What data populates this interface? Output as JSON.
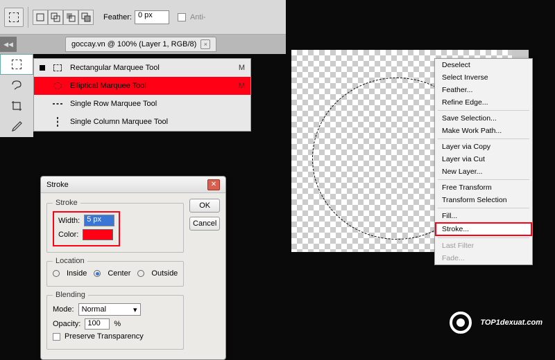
{
  "options_bar": {
    "feather_label": "Feather:",
    "feather_value": "0 px",
    "anti_alias_label": "Anti-"
  },
  "tab": {
    "title": "goccay.vn @ 100% (Layer 1, RGB/8)"
  },
  "marquee_flyout": {
    "items": [
      {
        "label": "Rectangular Marquee Tool",
        "key": "M"
      },
      {
        "label": "Elliptical Marquee Tool",
        "key": "M"
      },
      {
        "label": "Single Row Marquee Tool",
        "key": ""
      },
      {
        "label": "Single Column Marquee Tool",
        "key": ""
      }
    ]
  },
  "stroke_dialog": {
    "title": "Stroke",
    "ok": "OK",
    "cancel": "Cancel",
    "group_stroke": "Stroke",
    "width_label": "Width:",
    "width_value": "5 px",
    "color_label": "Color:",
    "color_hex": "#ff0015",
    "group_location": "Location",
    "loc_inside": "Inside",
    "loc_center": "Center",
    "loc_outside": "Outside",
    "group_blending": "Blending",
    "mode_label": "Mode:",
    "mode_value": "Normal",
    "opacity_label": "Opacity:",
    "opacity_value": "100",
    "opacity_unit": "%",
    "preserve": "Preserve Transparency"
  },
  "context_menu": {
    "items": [
      {
        "label": "Deselect",
        "disabled": false
      },
      {
        "label": "Select Inverse",
        "disabled": false
      },
      {
        "label": "Feather...",
        "disabled": false
      },
      {
        "label": "Refine Edge...",
        "disabled": false
      },
      {
        "sep": true
      },
      {
        "label": "Save Selection...",
        "disabled": false
      },
      {
        "label": "Make Work Path...",
        "disabled": false
      },
      {
        "sep": true
      },
      {
        "label": "Layer via Copy",
        "disabled": false
      },
      {
        "label": "Layer via Cut",
        "disabled": false
      },
      {
        "label": "New Layer...",
        "disabled": false
      },
      {
        "sep": true
      },
      {
        "label": "Free Transform",
        "disabled": false
      },
      {
        "label": "Transform Selection",
        "disabled": false
      },
      {
        "sep": true
      },
      {
        "label": "Fill...",
        "disabled": false
      },
      {
        "label": "Stroke...",
        "disabled": false,
        "highlight": true
      },
      {
        "sep": true
      },
      {
        "label": "Last Filter",
        "disabled": true
      },
      {
        "label": "Fade...",
        "disabled": true
      }
    ]
  },
  "watermark": {
    "text": "TOP1dexuat.com"
  }
}
